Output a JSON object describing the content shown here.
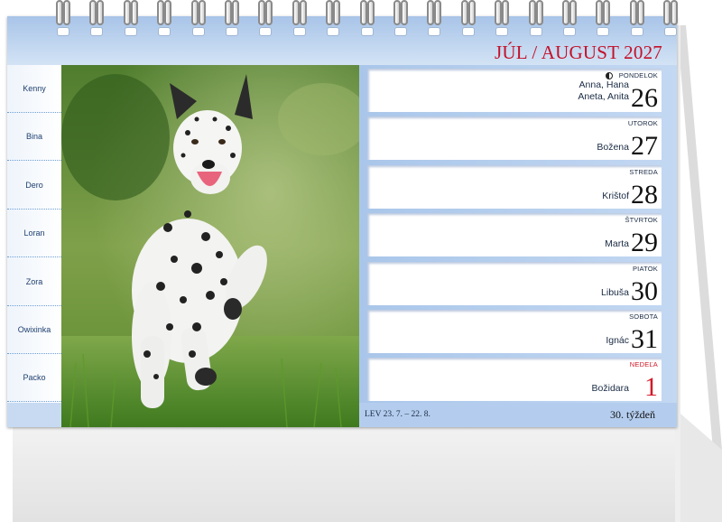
{
  "title": "JÚL / AUGUST 2027",
  "names": [
    "Kenny",
    "Bina",
    "Dero",
    "Loran",
    "Zora",
    "Owixinka",
    "Packo"
  ],
  "days": [
    {
      "dow": "PONDELOK",
      "num": "26",
      "name1": "Anna, Hana",
      "name2": "Aneta, Anita",
      "holiday": false,
      "moon": true
    },
    {
      "dow": "UTOROK",
      "num": "27",
      "name1": "Božena",
      "name2": "",
      "holiday": false,
      "moon": false
    },
    {
      "dow": "STREDA",
      "num": "28",
      "name1": "Krištof",
      "name2": "",
      "holiday": false,
      "moon": false
    },
    {
      "dow": "ŠTVRTOK",
      "num": "29",
      "name1": "Marta",
      "name2": "",
      "holiday": false,
      "moon": false
    },
    {
      "dow": "PIATOK",
      "num": "30",
      "name1": "Libuša",
      "name2": "",
      "holiday": false,
      "moon": false
    },
    {
      "dow": "SOBOTA",
      "num": "31",
      "name1": "Ignác",
      "name2": "",
      "holiday": false,
      "moon": false
    },
    {
      "dow": "NEDEĽA",
      "num": "1",
      "name1": "Božidara",
      "name2": "",
      "holiday": true,
      "moon": false
    }
  ],
  "zodiac": "LEV  23. 7. – 22. 8.",
  "week": "30. týždeň",
  "colors": {
    "accent_red": "#c3112a",
    "frame_blue": "#b4cdee",
    "text_dark": "#1a2b44"
  }
}
